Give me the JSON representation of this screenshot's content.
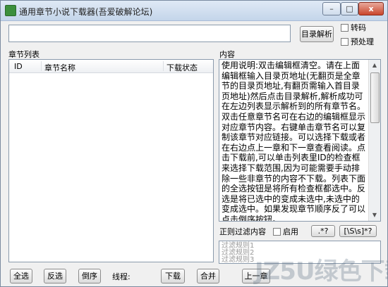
{
  "window": {
    "title": "通用章节小说下载器(吾爱破解论坛)",
    "minimize_label": "–",
    "maximize_label": "□",
    "close_label": "x"
  },
  "url_input": {
    "value": "",
    "placeholder": ""
  },
  "toolbar": {
    "parse_label": "目录解析",
    "transcode_label": "转码",
    "preprocess_label": "预处理"
  },
  "chapter_list": {
    "title": "章节列表",
    "columns": {
      "id": "ID",
      "name": "章节名称",
      "status": "下载状态"
    }
  },
  "content": {
    "title": "内容",
    "text": "使用说明:双击编辑框清空。请在上面编辑框输入目录页地址(无翻页是全章节的目录页地址,有翻页需输入首目录页地址)然后点击目录解析,解析成功可在左边列表显示解析到的所有章节名。双击任意章节名可在右边的编辑框显示对应章节内容。右键单击章节名可以复制该章节对应链接。可以选择下载或者在右边点上一章和下一章查看阅读。点击下载前,可以单击列表里ID的检查框来选择下载范围,因为可能需要手动排除一些非章节的内容不下载。列表下面的全选按钮是将所有检查框都选中。反选是将已选中的变成未选中,未选中的变成选中。如果发现章节顺序反了可以点击倒序按钮。"
  },
  "regex": {
    "label": "正则过滤内容",
    "enable_label": "启用",
    "pattern1_label": ".*?",
    "pattern2_label": "[\\S\\s]*?",
    "rules": [
      "过滤规则1",
      "过滤规则2",
      "过滤规则3"
    ]
  },
  "bottom_bar": {
    "select_all_label": "全选",
    "invert_label": "反选",
    "reverse_label": "倒序",
    "threads_label": "线程:",
    "download_label": "下载",
    "merge_label": "合并",
    "prev_label": "上一章"
  },
  "watermark": "JZ5U绿色下载"
}
